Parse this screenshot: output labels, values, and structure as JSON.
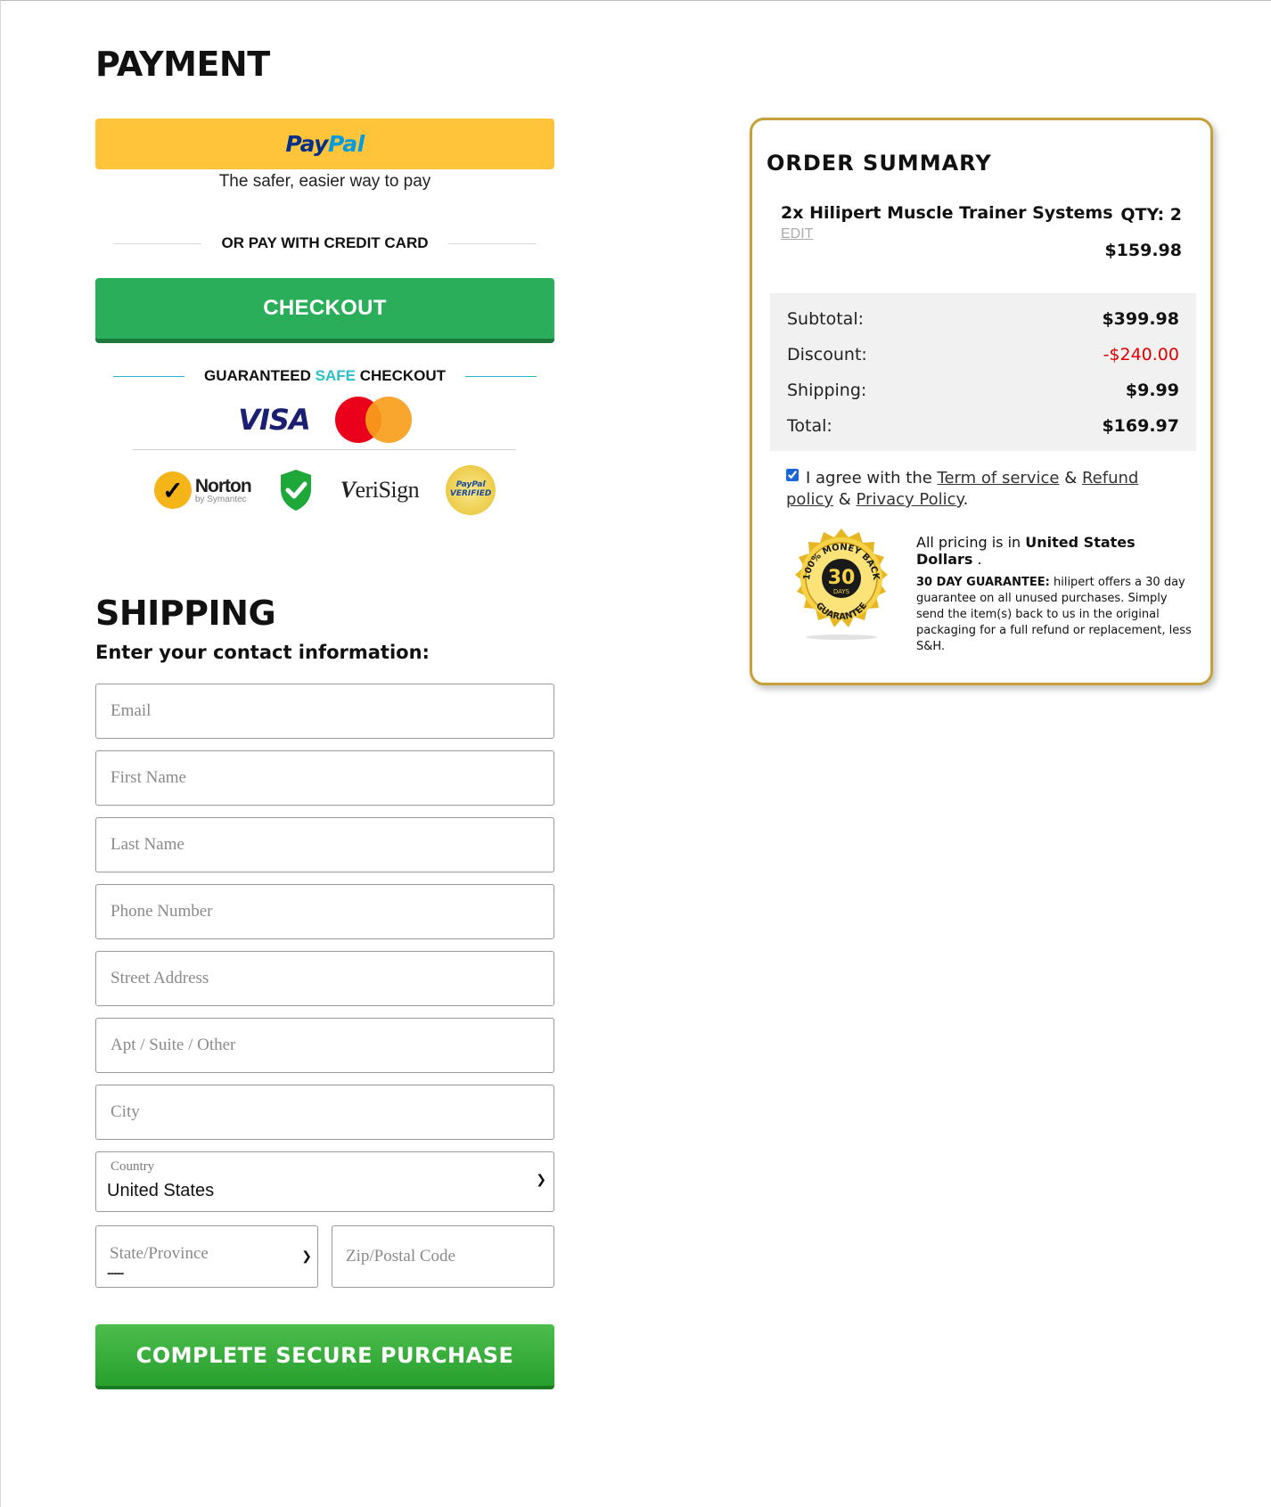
{
  "payment": {
    "title": "PAYMENT",
    "paypal_logo_pay": "Pay",
    "paypal_logo_pal": "Pal",
    "paypal_subtitle": "The safer, easier way to pay",
    "or_divider": "OR PAY WITH CREDIT CARD",
    "checkout_label": "CHECKOUT",
    "guaranteed_pre": "GUARANTEED ",
    "guaranteed_safe": "SAFE",
    "guaranteed_post": " CHECKOUT",
    "visa_label": "VISA",
    "badges": {
      "norton": "Norton",
      "norton_sub": "by Symantec",
      "verisign": "eriSign",
      "verisign_v": "V",
      "paypal_verified_1": "PayPal",
      "paypal_verified_2": "VERIFIED"
    },
    "colors": {
      "paypal_yellow": "#ffc43a",
      "checkout_green": "#2aae59",
      "safe_teal": "#27c0c9"
    }
  },
  "shipping": {
    "title": "SHIPPING",
    "subtitle": "Enter your contact information:",
    "email_placeholder": "Email",
    "first_name_placeholder": "First Name",
    "last_name_placeholder": "Last Name",
    "phone_placeholder": "Phone Number",
    "street_placeholder": "Street Address",
    "apt_placeholder": "Apt / Suite / Other",
    "city_placeholder": "City",
    "country_label": "Country",
    "country_value": "United States",
    "state_placeholder": "State/Province",
    "state_value": "-----",
    "zip_placeholder": "Zip/Postal Code",
    "purchase_label": "COMPLETE SECURE PURCHASE"
  },
  "order_summary": {
    "title": "ORDER SUMMARY",
    "product_name": "2x Hilipert Muscle Trainer Systems",
    "edit_label": "EDIT",
    "qty_label": "QTY: 2",
    "product_price": "$159.98",
    "subtotal_label": "Subtotal:",
    "subtotal_value": "$399.98",
    "discount_label": "Discount:",
    "discount_value": "-$240.00",
    "shipping_label": "Shipping:",
    "shipping_value": "$9.99",
    "total_label": "Total:",
    "total_value": "$169.97",
    "agree_text": "I agree with the",
    "term_link": "Term of service",
    "amp1": "&",
    "refund_link": "Refund policy",
    "amp2": "&",
    "privacy_link": "Privacy Policy",
    "period": ".",
    "pricing_pre": "All pricing is in",
    "pricing_currency": "United States Dollars",
    "pricing_post": ".",
    "guarantee_bold": "30 DAY GUARANTEE:",
    "guarantee_body": "hilipert offers a 30 day guarantee on all unused purchases. Simply send the item(s) back to us in the original packaging for a full refund or replacement, less S&H.",
    "seal_number": "30",
    "seal_days": "DAYS",
    "seal_top": "100% MONEY BACK",
    "seal_bottom": "GUARANTEE",
    "colors": {
      "border_gold": "#c6a03a",
      "discount_red": "#e00000"
    }
  }
}
